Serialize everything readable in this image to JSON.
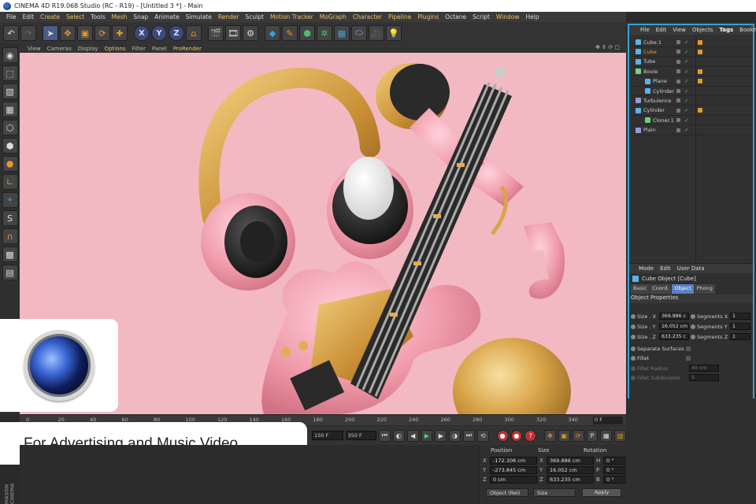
{
  "window": {
    "title": "CINEMA 4D R19.068 Studio (RC - R19) - [Untitled 3 *] - Main"
  },
  "menubar": [
    "File",
    "Edit",
    "Create",
    "Select",
    "Tools",
    "Mesh",
    "Snap",
    "Animate",
    "Simulate",
    "Render",
    "Sculpt",
    "Motion Tracker",
    "MoGraph",
    "Character",
    "Pipeline",
    "Plugins",
    "Octane",
    "Script",
    "Window",
    "Help"
  ],
  "viewport_menu": [
    "View",
    "Cameras",
    "Display",
    "Options",
    "Filter",
    "Panel",
    "ProRender"
  ],
  "timeline": {
    "ticks": [
      "0",
      "20",
      "40",
      "60",
      "80",
      "100",
      "120",
      "140",
      "160",
      "180",
      "200",
      "220",
      "240",
      "260",
      "280",
      "300",
      "320",
      "340"
    ],
    "frame": "0 F"
  },
  "playbar": {
    "start": "150 F",
    "end": "350 F"
  },
  "object_manager": {
    "menu": [
      "File",
      "Edit",
      "View",
      "Objects",
      "Tags",
      "Bookm"
    ],
    "objects": [
      {
        "name": "Cube.1",
        "level": 0,
        "hl": false,
        "icon": "cube-icon"
      },
      {
        "name": "Cube",
        "level": 0,
        "hl": true,
        "icon": "cube-icon"
      },
      {
        "name": "Tube",
        "level": 0,
        "hl": false,
        "icon": "tube-icon"
      },
      {
        "name": "Boole",
        "level": 0,
        "hl": false,
        "icon": "boole-icon"
      },
      {
        "name": "Plane",
        "level": 1,
        "hl": false,
        "icon": "plane-icon"
      },
      {
        "name": "Cylinder",
        "level": 1,
        "hl": false,
        "icon": "cylinder-icon"
      },
      {
        "name": "Turbulence",
        "level": 0,
        "hl": false,
        "icon": "turbulence-icon"
      },
      {
        "name": "Cylinder",
        "level": 0,
        "hl": false,
        "icon": "cylinder-icon"
      },
      {
        "name": "Cloner.1",
        "level": 1,
        "hl": false,
        "icon": "cloner-icon"
      },
      {
        "name": "Plain",
        "level": 0,
        "hl": false,
        "icon": "plain-icon"
      }
    ]
  },
  "attributes": {
    "menu": [
      "Mode",
      "Edit",
      "User Data"
    ],
    "title": "Cube Object [Cube]",
    "tabs": [
      "Basic",
      "Coord.",
      "Object",
      "Phong"
    ],
    "active_tab": "Object",
    "section": "Object Properties",
    "size_x_label": "Size . X",
    "size_x": "369.886 c",
    "size_y_label": "Size . Y",
    "size_y": "16.052 cm",
    "size_z_label": "Size . Z",
    "size_z": "633.235 c",
    "seg_x_label": "Segments X",
    "seg_x": "1",
    "seg_y_label": "Segments Y",
    "seg_y": "1",
    "seg_z_label": "Segments Z",
    "seg_z": "1",
    "separate": "Separate Surfaces",
    "fillet": "Fillet",
    "fillet_radius": "Fillet Radius",
    "fillet_radius_val": "40 cm",
    "fillet_sub": "Fillet Subdivision",
    "fillet_sub_val": "5"
  },
  "coordinates": {
    "headers": {
      "position": "Position",
      "size": "Size",
      "rotation": "Rotation"
    },
    "rows": [
      {
        "axis": "X",
        "pos": "-172.306 cm",
        "size": "369.886 cm",
        "rlab": "H",
        "rot": "0 °"
      },
      {
        "axis": "Y",
        "pos": "-273.845 cm",
        "size": "16.052 cm",
        "rlab": "P",
        "rot": "0 °"
      },
      {
        "axis": "Z",
        "pos": "0 cm",
        "size": "633.235 cm",
        "rlab": "B",
        "rot": "0 °"
      }
    ],
    "mode": "Object (Rel)",
    "size_mode": "Size",
    "apply": "Apply"
  },
  "caption": "For Advertising and Music Video",
  "maxon": "MAXON CINEMA",
  "colors": {
    "accent": "#2da6d8",
    "highlight": "#e8a13a",
    "viewport_bg": "#f3b9c2"
  }
}
